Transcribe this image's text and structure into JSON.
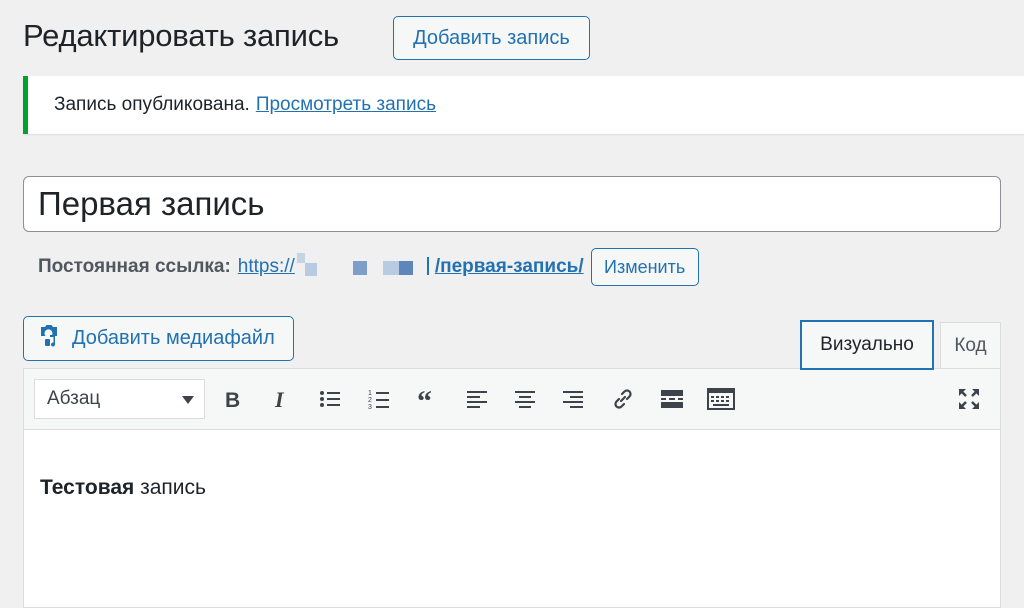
{
  "header": {
    "title": "Редактировать запись",
    "add_new_label": "Добавить запись"
  },
  "notice": {
    "message": "Запись опубликована.",
    "link_label": "Просмотреть запись",
    "accent_color": "#00a32a"
  },
  "post": {
    "title_value": "Первая запись"
  },
  "permalink": {
    "label": "Постоянная ссылка:",
    "url_prefix": "https://",
    "slug": "/первая-запись/",
    "edit_label": "Изменить"
  },
  "media": {
    "add_media_label": "Добавить медиафайл",
    "icon": "camera-music-icon"
  },
  "editor_tabs": {
    "visual_label": "Визуально",
    "code_label": "Код",
    "active": "visual"
  },
  "toolbar": {
    "format_value": "Абзац",
    "buttons": [
      "bold-icon",
      "italic-icon",
      "bullet-list-icon",
      "numbered-list-icon",
      "blockquote-icon",
      "align-left-icon",
      "align-center-icon",
      "align-right-icon",
      "link-icon",
      "read-more-icon",
      "toolbar-toggle-icon",
      "fullscreen-icon"
    ]
  },
  "content": {
    "bold_word": "Тестовая",
    "rest_text": " запись"
  },
  "colors": {
    "accent": "#2271b1",
    "background": "#f0f0f1"
  }
}
